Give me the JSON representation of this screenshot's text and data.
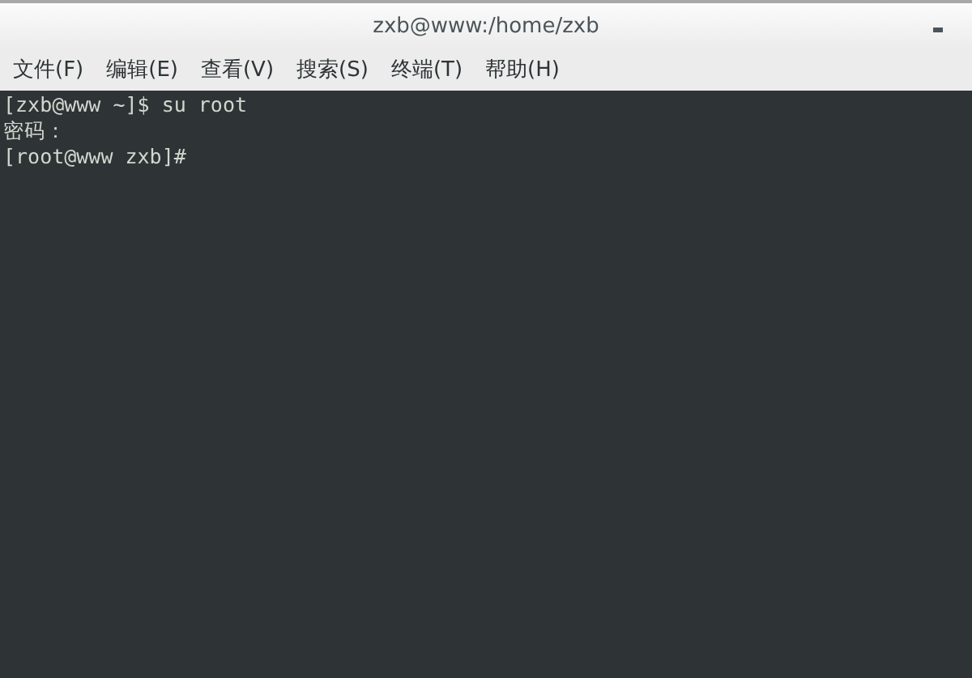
{
  "window": {
    "title": "zxb@www:/home/zxb"
  },
  "menu": [
    "文件(F)",
    "编辑(E)",
    "查看(V)",
    "搜索(S)",
    "终端(T)",
    "帮助(H)"
  ],
  "terminal": {
    "lines": [
      "[zxb@www ~]$ su root",
      "密码：",
      "[root@www zxb]#"
    ]
  }
}
